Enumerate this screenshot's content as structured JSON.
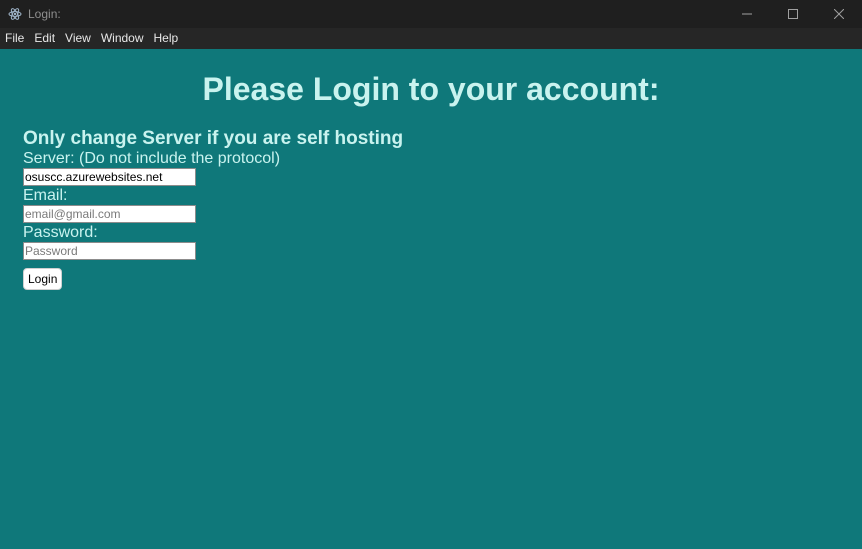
{
  "window": {
    "title": "Login:",
    "icon": "electron-icon",
    "controls": {
      "minimize_icon": "minimize-icon",
      "maximize_icon": "maximize-icon",
      "close_icon": "close-icon"
    }
  },
  "menu": {
    "items": [
      {
        "label": "File"
      },
      {
        "label": "Edit"
      },
      {
        "label": "View"
      },
      {
        "label": "Window"
      },
      {
        "label": "Help"
      }
    ]
  },
  "main": {
    "heading": "Please Login to your account:",
    "subheading": "Only change Server if you are self hosting",
    "server": {
      "label": "Server: (Do not include the protocol)",
      "value": "osuscc.azurewebsites.net"
    },
    "email": {
      "label": "Email:",
      "placeholder": "email@gmail.com"
    },
    "password": {
      "label": "Password:",
      "placeholder": "Password"
    },
    "login_button": "Login"
  },
  "colors": {
    "background": "#0f787a",
    "titlebar": "#1f1f1f",
    "menubar": "#262626",
    "text": "#c9f3ef"
  }
}
